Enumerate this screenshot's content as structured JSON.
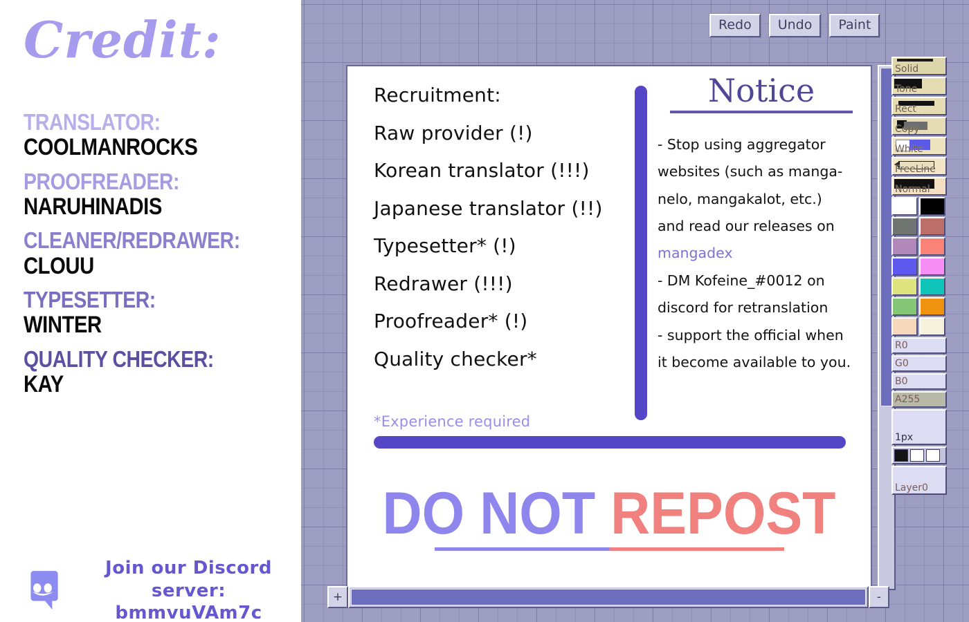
{
  "credit": {
    "title": "Credit:",
    "entries": [
      {
        "role": "TRANSLATOR:",
        "name": "COOLMANROCKS",
        "role_color": "#b9aeea"
      },
      {
        "role": "PROOFREADER:",
        "name": "NARUHINADIS",
        "role_color": "#a79ce2"
      },
      {
        "role": "CLEANER/REDRAWER:",
        "name": "CLOUU",
        "role_color": "#8b80cd"
      },
      {
        "role": "TYPESETTER:",
        "name": "WINTER",
        "role_color": "#7a6fbf"
      },
      {
        "role": "QUALITY CHECKER:",
        "name": "KAY",
        "role_color": "#5b4fa0"
      }
    ],
    "discord": {
      "icon": "discord-icon",
      "line1": "Join our Discord server:",
      "line2": "bmmvuVAm7c"
    }
  },
  "paint": {
    "toolbar": [
      {
        "label": "Redo",
        "name": "redo-button"
      },
      {
        "label": "Undo",
        "name": "undo-button"
      },
      {
        "label": "Paint",
        "name": "paint-button"
      }
    ],
    "scroll": {
      "plus": "+",
      "minus": "-"
    },
    "palette": {
      "tools": [
        {
          "label": "Solid",
          "glyph": "solid",
          "bg": "#ddd6ab"
        },
        {
          "label": "Tone",
          "glyph": "tone",
          "bg": "#e6dcb4"
        },
        {
          "label": "Rect",
          "glyph": "rect",
          "bg": "#e6dcb4"
        },
        {
          "label": "Copy",
          "glyph": "copy",
          "bg": "#e6dcb4"
        },
        {
          "label": "White",
          "glyph": "white",
          "bg": "#ede3be"
        },
        {
          "label": "FreeLine",
          "glyph": "pencil",
          "bg": "#f2e6c6"
        },
        {
          "label": "Normal",
          "glyph": "normal",
          "bg": "#f4dfc2"
        }
      ],
      "swatches": [
        [
          "#ffffff",
          "#000000"
        ],
        [
          "#6f7571",
          "#bc6e68"
        ],
        [
          "#b287ba",
          "#fa8279"
        ],
        [
          "#5f5aef",
          "#f78ef5"
        ],
        [
          "#e0e47e",
          "#0fc4b8"
        ],
        [
          "#85c776",
          "#ee9210"
        ],
        [
          "#f6d9bb",
          "#f7f2dc"
        ]
      ],
      "channels": [
        {
          "label": "R0",
          "selected": false
        },
        {
          "label": "G0",
          "selected": false
        },
        {
          "label": "B0",
          "selected": false
        },
        {
          "label": "A255",
          "selected": true
        }
      ],
      "brush_size": "1px",
      "mini_swatches": [
        "#141414",
        "#ffffff",
        "#ffffff"
      ],
      "layer": "Layer0"
    }
  },
  "canvas": {
    "recruitment": {
      "heading": "Recruitment:",
      "roles": [
        "Raw provider (!)",
        "Korean translator (!!!)",
        "Japanese translator (!!)",
        "Typesetter* (!)",
        "Redrawer (!!!)",
        "Proofreader* (!)",
        "Quality checker*"
      ],
      "footnote": "*Experience required"
    },
    "notice": {
      "title": "Notice",
      "items": [
        "- Stop using aggregator websites (such as manga-nelo, mangakalot, etc.) and read our releases on",
        "- DM Kofeine_#0012 on discord for retranslation",
        "- support the official when it become available to you."
      ],
      "item1_a": "- Stop using aggregator",
      "item1_b": "websites (such as manga-",
      "item1_c": "nelo, mangakalot, etc.)",
      "item1_d": "and read our releases on",
      "link": "mangadex",
      "item2_a": "- DM Kofeine_#0012 on",
      "item2_b": "discord for retranslation",
      "item3_a": "- support the official when",
      "item3_b": "it become available to you."
    },
    "warning": {
      "part1": "DO NOT ",
      "part2": "REPOST",
      "color1": "#8f86ed",
      "color2": "#f0817e"
    }
  }
}
